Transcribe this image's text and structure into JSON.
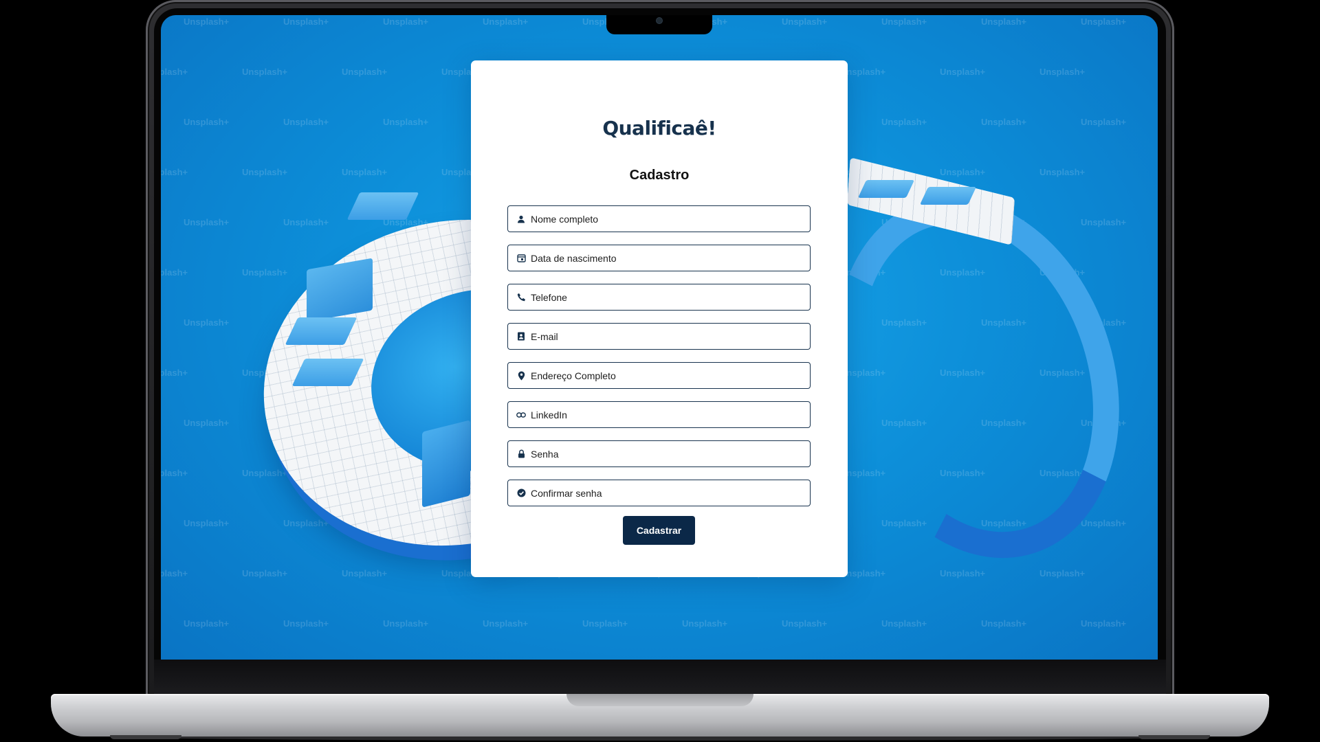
{
  "app": {
    "logo_text": "Qualificaê!",
    "watermark_text": "Unsplash+"
  },
  "form": {
    "title": "Cadastro",
    "fields": [
      {
        "id": "nome",
        "placeholder": "Nome completo",
        "icon": "user-icon",
        "type": "text"
      },
      {
        "id": "nascimento",
        "placeholder": "Data de nascimento",
        "icon": "calendar-icon",
        "type": "text"
      },
      {
        "id": "telefone",
        "placeholder": "Telefone",
        "icon": "phone-icon",
        "type": "tel"
      },
      {
        "id": "email",
        "placeholder": "E-mail",
        "icon": "contact-card-icon",
        "type": "email"
      },
      {
        "id": "endereco",
        "placeholder": "Endereço Completo",
        "icon": "location-pin-icon",
        "type": "text"
      },
      {
        "id": "linkedin",
        "placeholder": "LinkedIn",
        "icon": "link-icon",
        "type": "text"
      },
      {
        "id": "senha",
        "placeholder": "Senha",
        "icon": "lock-icon",
        "type": "password"
      },
      {
        "id": "confirmar",
        "placeholder": "Confirmar senha",
        "icon": "check-circle-icon",
        "type": "password"
      }
    ],
    "submit_label": "Cadastrar"
  },
  "colors": {
    "primary": "#0b2848",
    "field_border": "#17324d",
    "background": "#0d8fd9",
    "card": "#ffffff"
  }
}
